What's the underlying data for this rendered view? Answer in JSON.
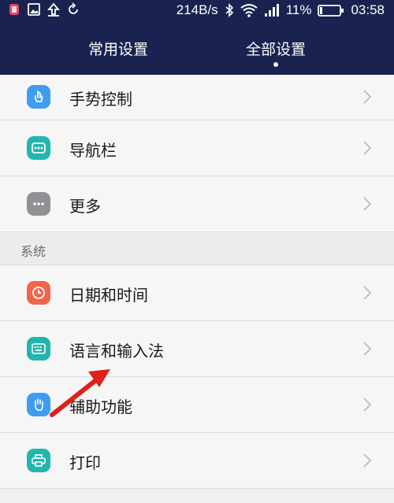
{
  "status_bar": {
    "network_speed": "214B/s",
    "battery": "11%",
    "time": "03:58"
  },
  "tabs": {
    "common": "常用设置",
    "all": "全部设置"
  },
  "section_title": "系统",
  "items_top": [
    {
      "label": "手势控制",
      "icon": "gesture-icon",
      "color": "#3f9cf0"
    },
    {
      "label": "导航栏",
      "icon": "navigation-bar-icon",
      "color": "#23b5b0"
    },
    {
      "label": "更多",
      "icon": "more-icon",
      "color": "#8f9194"
    }
  ],
  "items_system": [
    {
      "label": "日期和时间",
      "icon": "clock-icon",
      "color": "#f0664a"
    },
    {
      "label": "语言和输入法",
      "icon": "keyboard-icon",
      "color": "#22b5ad"
    },
    {
      "label": "辅助功能",
      "icon": "hand-icon",
      "color": "#3f9cf0"
    },
    {
      "label": "打印",
      "icon": "printer-icon",
      "color": "#23b5b0"
    }
  ],
  "colors": {
    "header_bg": "#1a2350",
    "annotation_arrow": "#e0201a"
  }
}
